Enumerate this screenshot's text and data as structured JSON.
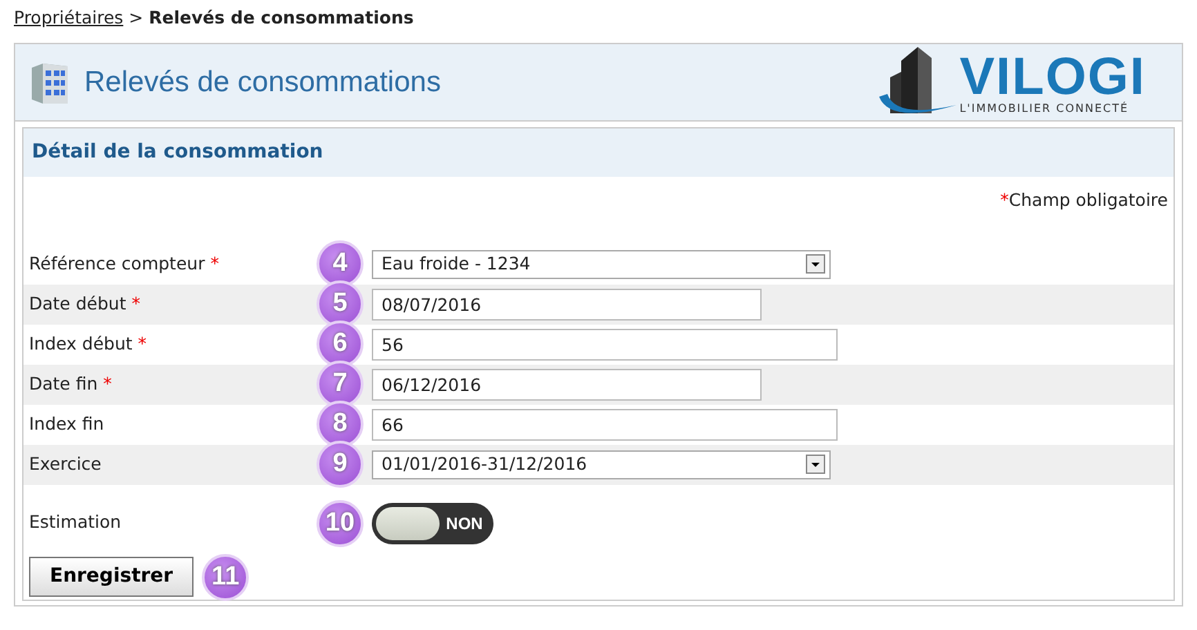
{
  "breadcrumb": {
    "link": "Propriétaires",
    "separator": ">",
    "current": "Relevés de consommations"
  },
  "page_title": "Relevés de consommations",
  "logo": {
    "name": "VILOGI",
    "tagline": "L'IMMOBILIER CONNECTÉ"
  },
  "section_title": "Détail de la consommation",
  "required_note": {
    "mark": "*",
    "text": "Champ obligatoire"
  },
  "fields": [
    {
      "label": "Référence compteur",
      "required": true,
      "kind": "select",
      "value": "Eau froide - 1234",
      "badge": "4"
    },
    {
      "label": "Date début",
      "required": true,
      "kind": "date",
      "value": "08/07/2016",
      "badge": "5"
    },
    {
      "label": "Index début",
      "required": true,
      "kind": "text",
      "value": "56",
      "badge": "6"
    },
    {
      "label": "Date fin",
      "required": true,
      "kind": "date",
      "value": "06/12/2016",
      "badge": "7"
    },
    {
      "label": "Index fin",
      "required": false,
      "kind": "text",
      "value": "66",
      "badge": "8"
    },
    {
      "label": "Exercice",
      "required": false,
      "kind": "select",
      "value": "01/01/2016-31/12/2016",
      "badge": "9"
    }
  ],
  "estimation": {
    "label": "Estimation",
    "on": false,
    "state_text": "NON",
    "badge": "10"
  },
  "save": {
    "label": "Enregistrer",
    "badge": "11"
  }
}
